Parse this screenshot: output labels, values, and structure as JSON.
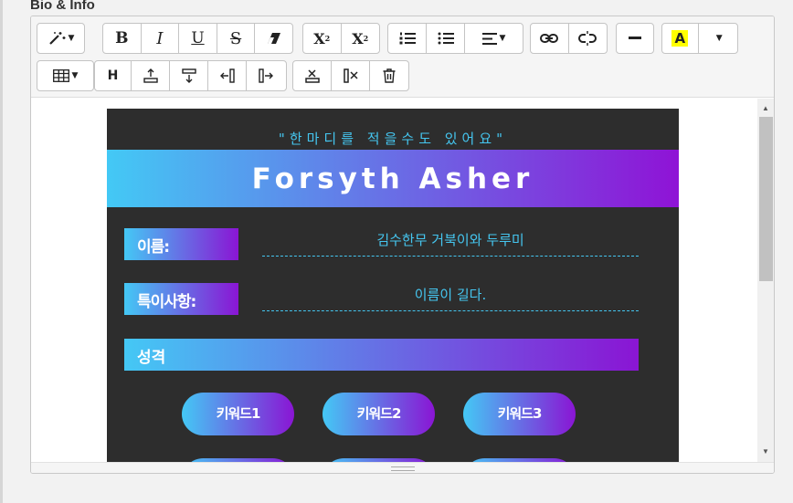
{
  "field_label": "Bio & Info",
  "toolbar": {
    "bold": "B",
    "italic": "I",
    "underline": "U",
    "strike": "S",
    "superscript": "X",
    "subscript": "X",
    "heading": "H",
    "font_color": "A"
  },
  "card": {
    "quote": "\"한마디를 적을수도 있어요\"",
    "name": "Forsyth Asher",
    "fields": [
      {
        "label": "이름:",
        "value": "김수한무 거북이와 두루미"
      },
      {
        "label": "특이사항:",
        "value": "이름이 길다."
      }
    ],
    "section_title": "성격",
    "keywords": [
      "키워드1",
      "키워드2",
      "키워드3"
    ]
  },
  "colors": {
    "gradient_start": "#43c9f5",
    "gradient_end": "#8f13d6",
    "card_bg": "#2d2d2d",
    "highlight_yellow": "#ffff00"
  }
}
